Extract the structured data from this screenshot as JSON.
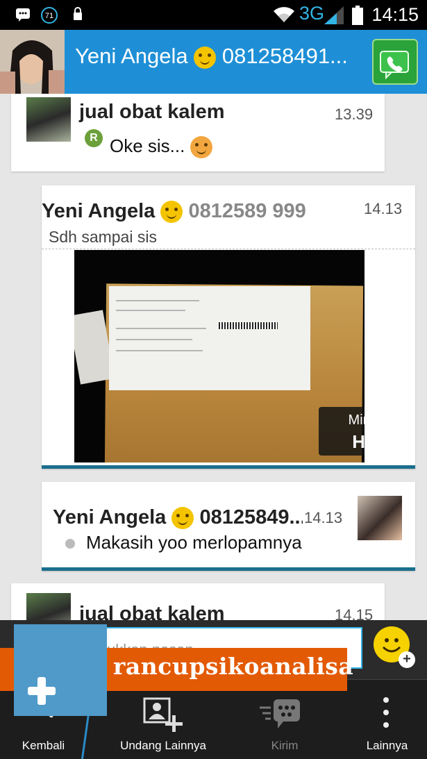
{
  "status_bar": {
    "notification_count": "71",
    "network_type": "3G",
    "time": "14:15"
  },
  "header": {
    "contact_name": "Yeni Angela",
    "contact_pin": "081258491...",
    "call_icon": "phone-icon"
  },
  "messages": [
    {
      "sender": "jual obat kalem",
      "time": "13.39",
      "text": "Oke sis...",
      "status_badge": "R"
    },
    {
      "sender": "Yeni Angela",
      "sender_pin": "0812589   999",
      "time": "14.13",
      "text": "Sdh sampai sis",
      "hd_button_line1": "Minta",
      "hd_button_line2": "HD"
    },
    {
      "sender": "Yeni Angela",
      "sender_pin": "08125849...",
      "time": "14.13",
      "text": "Makasih yoo merlopamnya"
    },
    {
      "sender": "jual obat kalem",
      "time": "14.15"
    }
  ],
  "composer": {
    "placeholder": "ukkan pesan"
  },
  "watermark": {
    "text": "rancupsikoanalisa"
  },
  "action_bar": {
    "items": [
      {
        "label": "Kembali",
        "icon": "search-icon"
      },
      {
        "label": "Undang Lainnya",
        "icon": "add-contact-icon"
      },
      {
        "label": "Kirim",
        "icon": "bbm-send-icon"
      },
      {
        "label": "Lainnya",
        "icon": "more-vertical-icon"
      }
    ]
  },
  "colors": {
    "header_blue": "#1e8fd6",
    "accent_cyan": "#33b5e5",
    "watermark_orange": "#e35a05",
    "outgoing_border": "#1a6e8e"
  }
}
